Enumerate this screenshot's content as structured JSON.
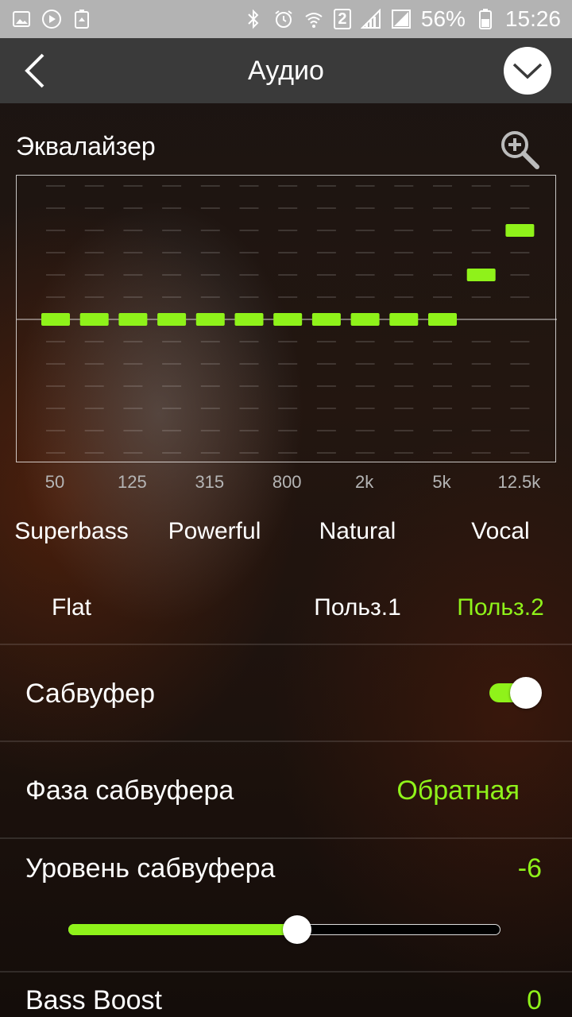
{
  "status_bar": {
    "battery_percent": "56%",
    "time": "15:26",
    "sim_badge": "2",
    "left_icons": [
      "gallery-icon",
      "play-icon",
      "battery-saver-icon"
    ],
    "right_icons": [
      "bluetooth-icon",
      "alarm-icon",
      "wifi-icon",
      "signal-icon",
      "signal-icon",
      "battery-icon"
    ]
  },
  "header": {
    "title": "Аудио"
  },
  "equalizer": {
    "title": "Эквалайзер",
    "frequency_labels": [
      "50",
      "125",
      "315",
      "800",
      "2k",
      "5k",
      "12.5k"
    ],
    "band_levels": [
      0,
      0,
      0,
      0,
      0,
      0,
      0,
      0,
      0,
      0,
      0,
      2,
      4
    ],
    "level_range": [
      -6,
      6
    ]
  },
  "presets": {
    "items": [
      "Superbass",
      "Powerful",
      "Natural",
      "Vocal",
      "Flat",
      "Польз.1",
      "Польз.2"
    ],
    "active": "Польз.2"
  },
  "settings": {
    "subwoofer": {
      "label": "Сабвуфер",
      "enabled": true
    },
    "subwoofer_phase": {
      "label": "Фаза сабвуфера",
      "value": "Обратная"
    },
    "subwoofer_level": {
      "label": "Уровень сабвуфера",
      "value": "-6",
      "fraction": 0.53
    },
    "bass_boost": {
      "label": "Bass Boost",
      "value": "0"
    }
  },
  "colors": {
    "accent": "#8ff21a",
    "status_bar": "#b3b3b3",
    "header": "#3a3a3a"
  }
}
